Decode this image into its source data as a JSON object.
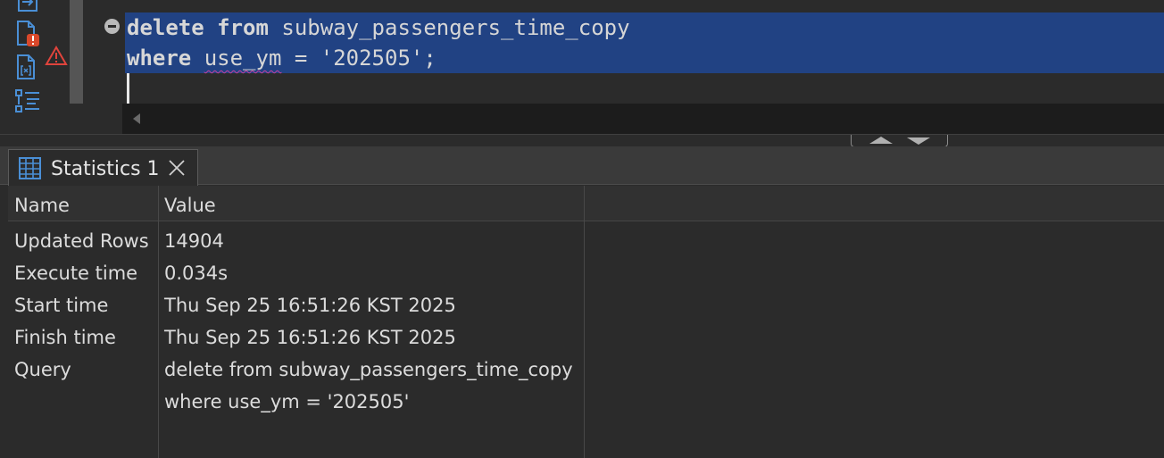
{
  "editor": {
    "line1": {
      "kw_delete": "delete",
      "kw_from": "from",
      "table": "subway_passengers_time_copy"
    },
    "line2": {
      "kw_where": "where",
      "column": "use_ym",
      "rest": " = '202505';"
    },
    "selection_color": "#214283"
  },
  "toolbar_icons": [
    "export-icon",
    "script-error-icon",
    "variables-icon",
    "outline-icon"
  ],
  "warning_icon": "warning-icon",
  "results": {
    "tab": {
      "label": "Statistics 1",
      "icon": "grid-icon"
    },
    "columns": [
      "Name",
      "Value"
    ],
    "rows": [
      {
        "name": "Updated Rows",
        "value": "14904"
      },
      {
        "name": "Execute time",
        "value": "0.034s"
      },
      {
        "name": "Start time",
        "value": "Thu Sep 25 16:51:26 KST 2025"
      },
      {
        "name": "Finish time",
        "value": "Thu Sep 25 16:51:26 KST 2025"
      },
      {
        "name": "Query",
        "value": "delete from subway_passengers_time_copy"
      },
      {
        "name": "",
        "value": "where use_ym = '202505'"
      }
    ]
  }
}
